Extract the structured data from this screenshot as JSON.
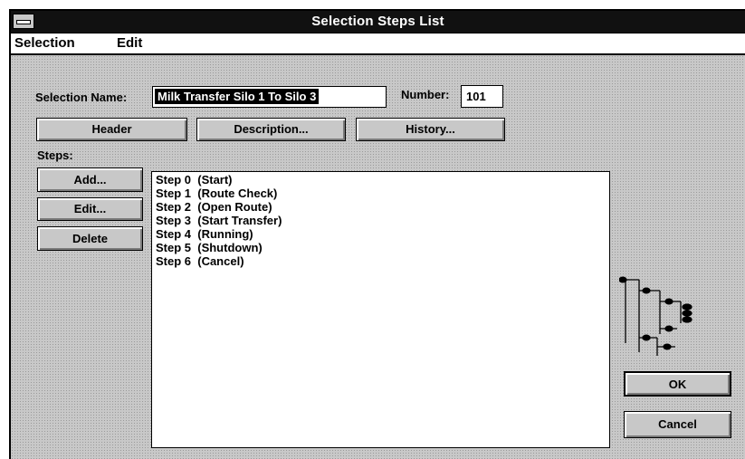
{
  "window": {
    "title": "Selection Steps List"
  },
  "menu": {
    "items": [
      {
        "label": "Selection"
      },
      {
        "label": "Edit"
      }
    ]
  },
  "form": {
    "selection_name_label": "Selection Name:",
    "selection_name_value": "Milk Transfer Silo 1 To Silo 3",
    "number_label": "Number:",
    "number_value": "101"
  },
  "buttons": {
    "header": "Header",
    "description": "Description...",
    "history": "History...",
    "add": "Add...",
    "edit": "Edit...",
    "delete": "Delete",
    "ok": "OK",
    "cancel": "Cancel"
  },
  "steps": {
    "label": "Steps:",
    "items": [
      {
        "label": "Step 0  (Start)"
      },
      {
        "label": "Step 1  (Route Check)"
      },
      {
        "label": "Step 2  (Open Route)"
      },
      {
        "label": "Step 3  (Start Transfer)"
      },
      {
        "label": "Step 4  (Running)"
      },
      {
        "label": "Step 5  (Shutdown)"
      },
      {
        "label": "Step 6  (Cancel)"
      }
    ]
  },
  "icons": {
    "tree": "tree-diagram-icon",
    "system_menu": "system-menu-icon"
  }
}
